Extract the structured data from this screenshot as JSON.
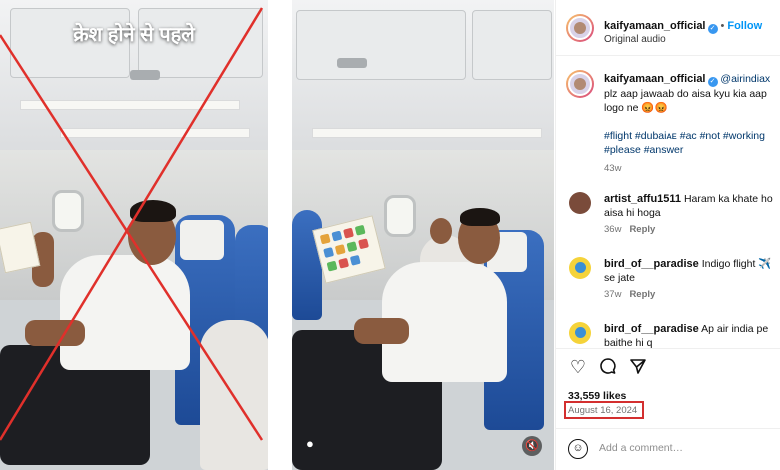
{
  "left_image": {
    "caption": "क्रेश होने से पहले"
  },
  "post": {
    "header": {
      "username": "kaifyamaan_official",
      "follow_label": "Follow",
      "subtitle": "Original audio",
      "separator": "•"
    },
    "caption": {
      "username": "kaifyamaan_official",
      "mention": "@airindiax",
      "text": " plz aap jawaab do aisa kyu kia aap logo ne 😡😡",
      "hashtags": "#flight #dubaiᴀᴇ #ac #not #working #please #answer",
      "time": "43w"
    },
    "comments": [
      {
        "username": "artist_affu1511",
        "text": "Haram ka khate ho aisa hi hoga",
        "time": "36w",
        "reply_label": "Reply"
      },
      {
        "username": "bird_of__paradise",
        "text": "Indigo flight ✈️ se jate",
        "time": "37w",
        "reply_label": "Reply"
      },
      {
        "username": "bird_of__paradise",
        "text": "Ap air india pe baithe hi q",
        "time": "",
        "reply_label": ""
      }
    ],
    "likes": "33,559 likes",
    "date": "August 16, 2024",
    "add_comment_placeholder": "Add a comment…"
  },
  "icons": {
    "heart": "heart-icon",
    "comment": "comment-icon",
    "share": "share-icon",
    "emoji": "smile-icon",
    "verified": "verified-badge-icon",
    "mute": "mute-icon",
    "user": "user-tag-icon"
  },
  "colors": {
    "cross_red": "#e0302b",
    "follow_blue": "#0095f6",
    "date_highlight": "#d32f2f",
    "hashtag": "#00376b"
  }
}
